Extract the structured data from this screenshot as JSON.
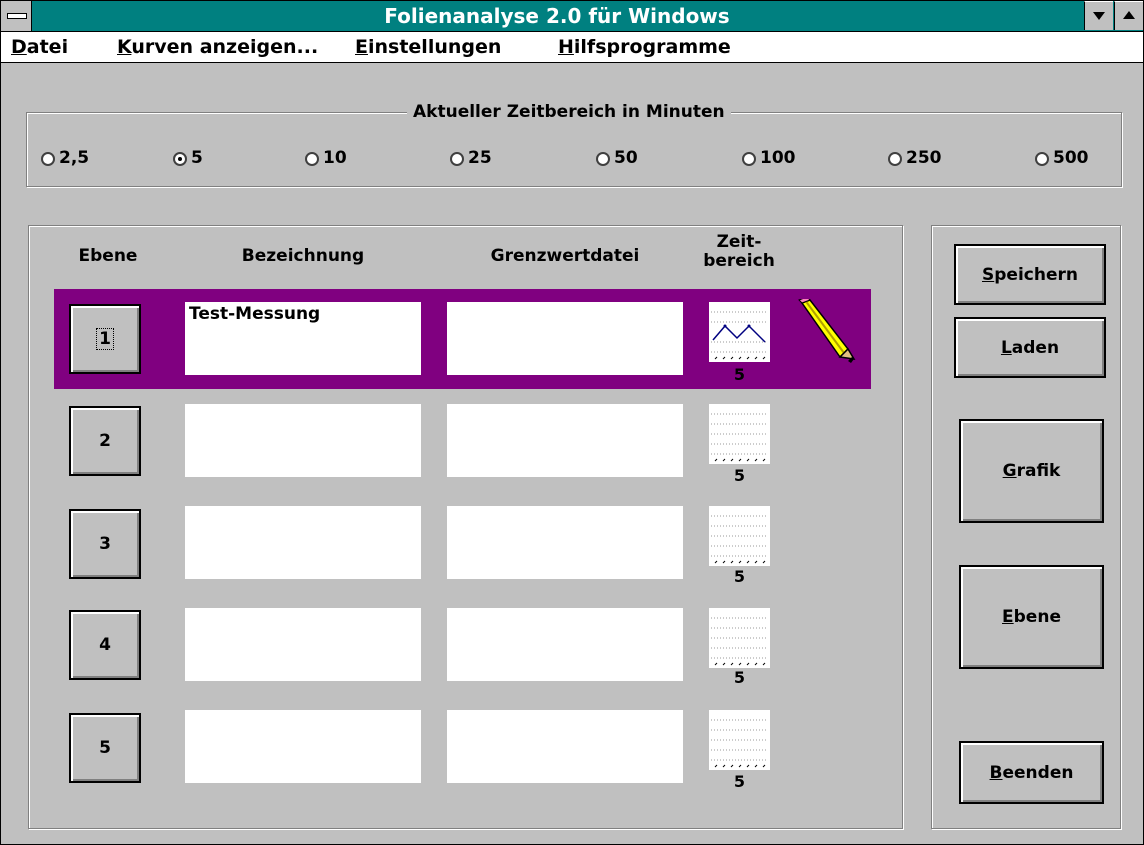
{
  "window": {
    "title": "Folienanalyse 2.0 für Windows"
  },
  "menu": [
    {
      "label": "Datei",
      "mnemonic": "D",
      "rest": "atei"
    },
    {
      "label": "Kurven anzeigen...",
      "mnemonic": "K",
      "rest": "urven anzeigen..."
    },
    {
      "label": "Einstellungen",
      "mnemonic": "E",
      "rest": "instellungen"
    },
    {
      "label": "Hilfsprogramme",
      "mnemonic": "H",
      "rest": "ilfsprogramme"
    }
  ],
  "zeitbereich": {
    "label": "Aktueller Zeitbereich in Minuten",
    "options": [
      "2,5",
      "5",
      "10",
      "25",
      "50",
      "100",
      "250",
      "500"
    ],
    "selected": "5"
  },
  "table": {
    "headers": {
      "ebene": "Ebene",
      "bezeichnung": "Bezeichnung",
      "grenzwertdatei": "Grenzwertdatei",
      "zeit1": "Zeit-",
      "zeit2": "bereich"
    },
    "rows": [
      {
        "ebene": "1",
        "bezeichnung": "Test-Messung",
        "grenzwertdatei": "",
        "zeitbereich": "5",
        "active": true
      },
      {
        "ebene": "2",
        "bezeichnung": "",
        "grenzwertdatei": "",
        "zeitbereich": "5",
        "active": false
      },
      {
        "ebene": "3",
        "bezeichnung": "",
        "grenzwertdatei": "",
        "zeitbereich": "5",
        "active": false
      },
      {
        "ebene": "4",
        "bezeichnung": "",
        "grenzwertdatei": "",
        "zeitbereich": "5",
        "active": false
      },
      {
        "ebene": "5",
        "bezeichnung": "",
        "grenzwertdatei": "",
        "zeitbereich": "5",
        "active": false
      }
    ]
  },
  "buttons": {
    "speichern": {
      "mn": "S",
      "rest": "peichern"
    },
    "laden": {
      "mn": "L",
      "rest": "aden"
    },
    "grafik": {
      "mn": "G",
      "rest": "rafik"
    },
    "ebene": {
      "mn": "E",
      "rest": "bene"
    },
    "beenden": {
      "mn": "B",
      "rest": "eenden"
    }
  },
  "icons": {
    "edit": "pencil-icon",
    "curve": "mini-chart-icon"
  },
  "colors": {
    "titlebar": "#008080",
    "active_row": "#800080",
    "face": "#c0c0c0"
  }
}
